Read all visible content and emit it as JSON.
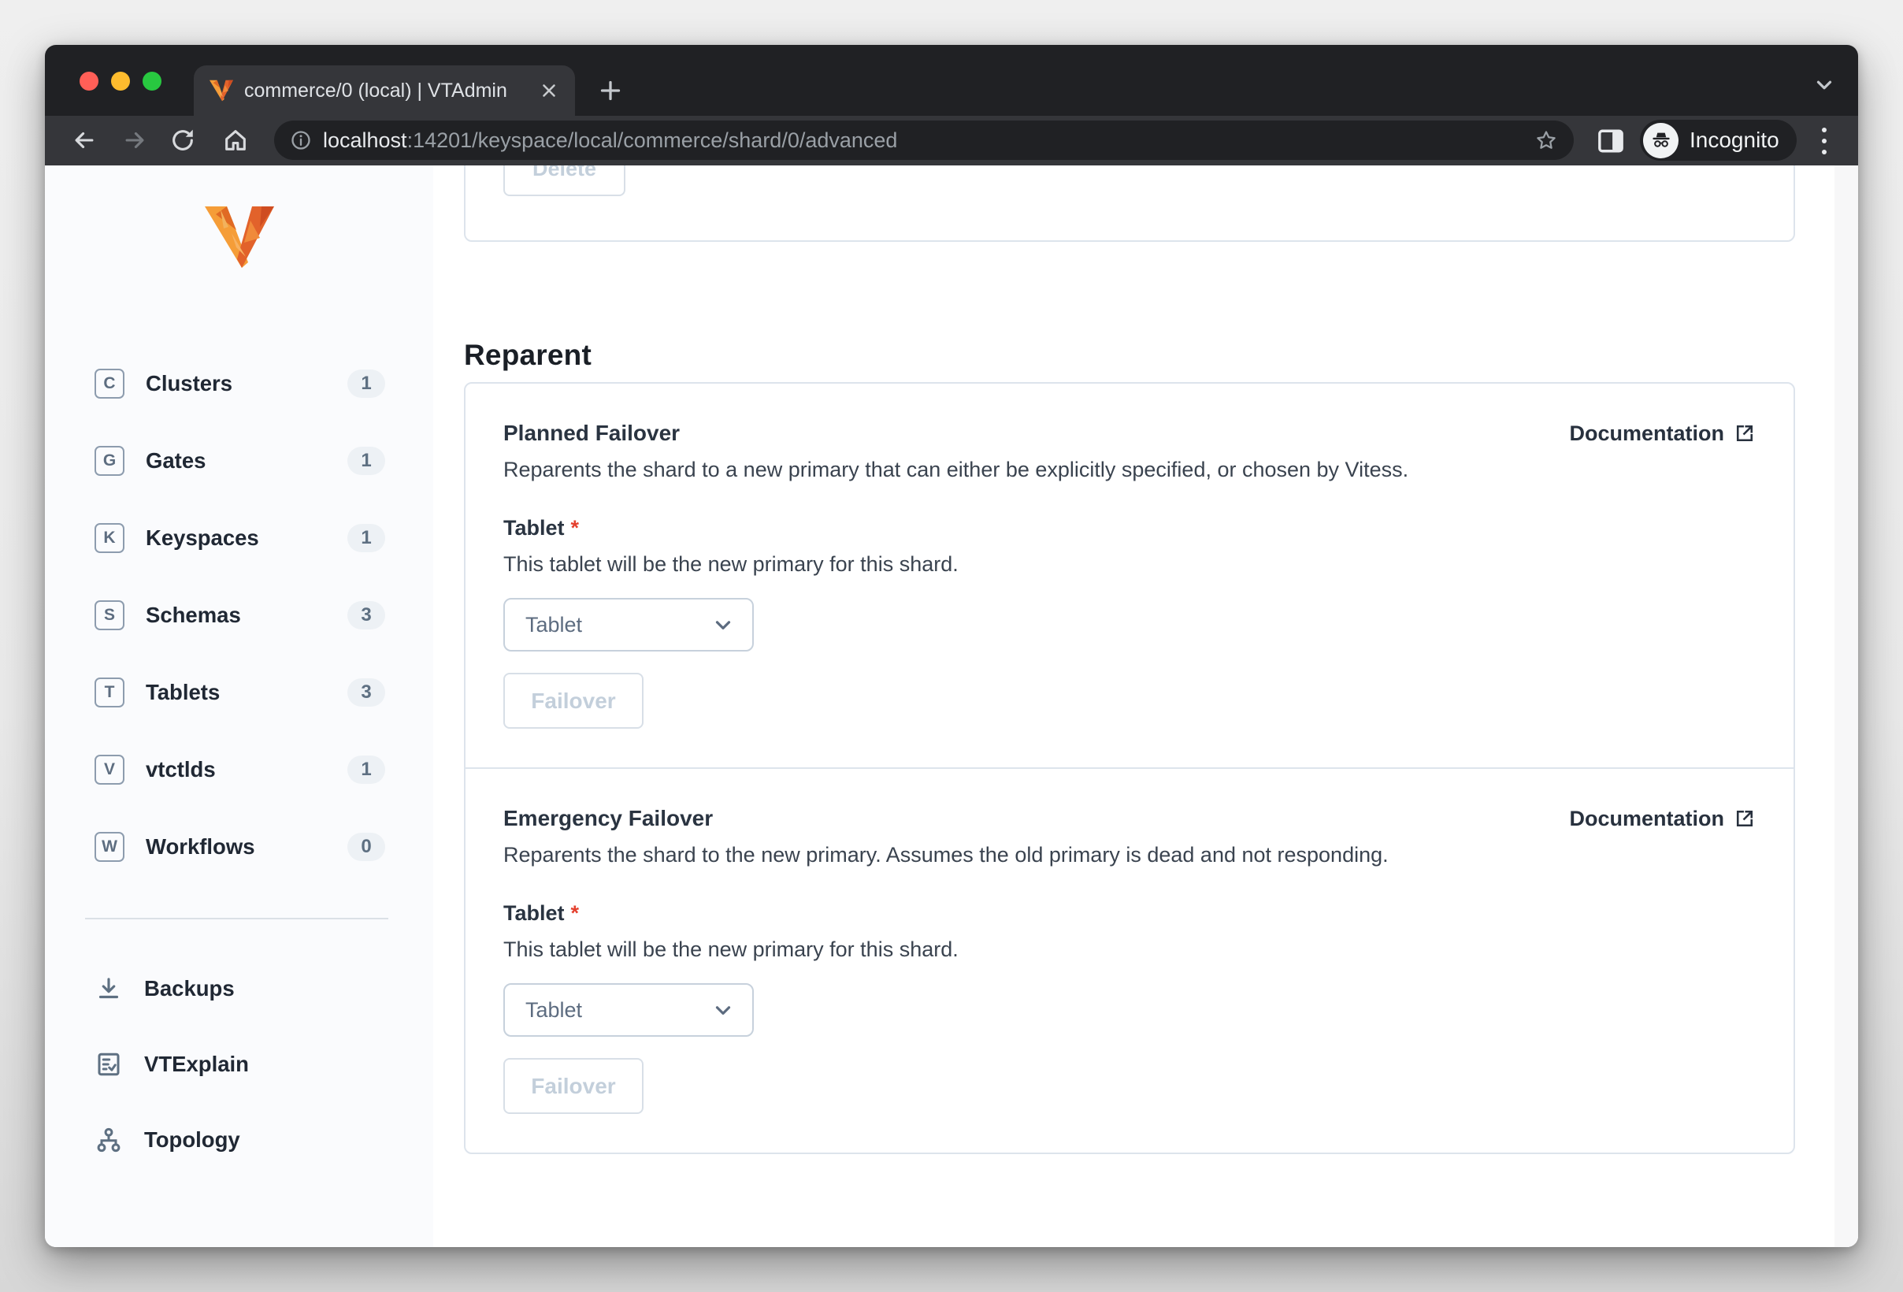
{
  "browser": {
    "tab_title": "commerce/0 (local) | VTAdmin",
    "url_host": "localhost",
    "url_path": ":14201/keyspace/local/commerce/shard/0/advanced",
    "incognito_label": "Incognito"
  },
  "sidebar": {
    "items": [
      {
        "letter": "C",
        "label": "Clusters",
        "count": "1"
      },
      {
        "letter": "G",
        "label": "Gates",
        "count": "1"
      },
      {
        "letter": "K",
        "label": "Keyspaces",
        "count": "1"
      },
      {
        "letter": "S",
        "label": "Schemas",
        "count": "3"
      },
      {
        "letter": "T",
        "label": "Tablets",
        "count": "3"
      },
      {
        "letter": "V",
        "label": "vtctlds",
        "count": "1"
      },
      {
        "letter": "W",
        "label": "Workflows",
        "count": "0"
      }
    ],
    "tools": [
      {
        "label": "Backups",
        "icon": "download-icon"
      },
      {
        "label": "VTExplain",
        "icon": "doc-check-icon"
      },
      {
        "label": "Topology",
        "icon": "topology-icon"
      }
    ]
  },
  "main": {
    "delete_button_label": "Delete",
    "heading": "Reparent",
    "sections": [
      {
        "title": "Planned Failover",
        "doc_label": "Documentation",
        "description": "Reparents the shard to a new primary that can either be explicitly specified, or chosen by Vitess.",
        "field_label": "Tablet",
        "required_mark": "*",
        "field_help": "This tablet will be the new primary for this shard.",
        "select_value": "Tablet",
        "action_label": "Failover"
      },
      {
        "title": "Emergency Failover",
        "doc_label": "Documentation",
        "description": "Reparents the shard to the new primary. Assumes the old primary is dead and not responding.",
        "field_label": "Tablet",
        "required_mark": "*",
        "field_help": "This tablet will be the new primary for this shard.",
        "select_value": "Tablet",
        "action_label": "Failover"
      }
    ]
  },
  "colors": {
    "brand_orange": "#e8692d",
    "required_red": "#e4402e",
    "disabled_text": "#c3cfdb",
    "dark_link": "#28313e"
  }
}
